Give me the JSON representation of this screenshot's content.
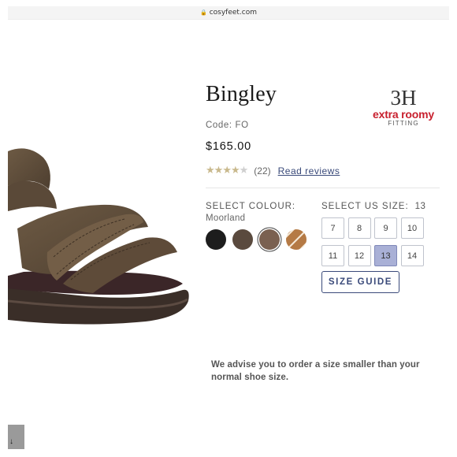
{
  "browser": {
    "url": "cosyfeet.com"
  },
  "product": {
    "name": "Bingley",
    "code_label": "Code:",
    "code": "FO",
    "price": "$165.00",
    "rating": {
      "value": 4,
      "out_of": 5,
      "count_text": "(22)",
      "reviews_link": "Read reviews"
    }
  },
  "fitting": {
    "code": "3H",
    "tagline": "extra roomy",
    "label": "FITTING",
    "brand_color": "#c8202e"
  },
  "colour": {
    "label": "SELECT COLOUR:",
    "selected": "Moorland",
    "swatches": [
      {
        "name": "black",
        "color": "#1d1d1d"
      },
      {
        "name": "brown",
        "color": "#5a4a3e"
      },
      {
        "name": "moorland",
        "color": "#7a6050",
        "selected": true
      },
      {
        "name": "tan-striped",
        "color": "#b57a45"
      }
    ]
  },
  "size": {
    "label": "SELECT US SIZE:",
    "selected": "13",
    "options": [
      "7",
      "8",
      "9",
      "10",
      "11",
      "12",
      "13",
      "14"
    ],
    "guide_label": "SIZE GUIDE"
  },
  "advice": "We advise you to order a size smaller than your normal shoe size.",
  "bottom_tab": {
    "glyph": "↓"
  },
  "colors": {
    "accent": "#3a4a7a",
    "selected_size": "#a9b0d6",
    "star": "#c9b98d"
  }
}
